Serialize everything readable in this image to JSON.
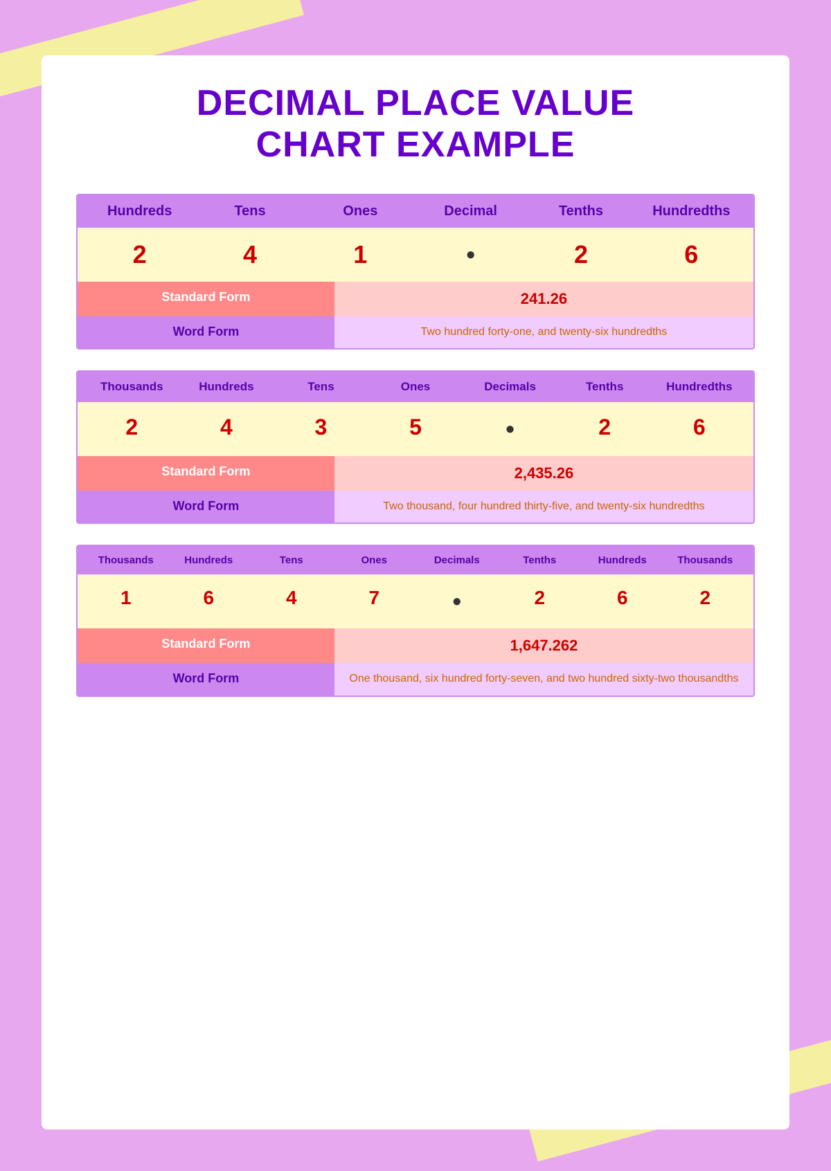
{
  "page": {
    "title_line1": "DECIMAL PLACE VALUE",
    "title_line2": "CHART EXAMPLE"
  },
  "charts": [
    {
      "id": "chart1",
      "cols": 6,
      "headers": [
        "Hundreds",
        "Tens",
        "Ones",
        "Decimal",
        "Tenths",
        "Hundredths"
      ],
      "digits": [
        "2",
        "4",
        "1",
        "•",
        "2",
        "6"
      ],
      "dot_index": 3,
      "standard_form_label": "Standard Form",
      "standard_form_value": "241.26",
      "word_form_label": "Word Form",
      "word_form_value": "Two hundred forty-one, and twenty-six hundredths"
    },
    {
      "id": "chart2",
      "cols": 7,
      "headers": [
        "Thousands",
        "Hundreds",
        "Tens",
        "Ones",
        "Decimals",
        "Tenths",
        "Hundredths"
      ],
      "digits": [
        "2",
        "4",
        "3",
        "5",
        "•",
        "2",
        "6"
      ],
      "dot_index": 4,
      "standard_form_label": "Standard Form",
      "standard_form_value": "2,435.26",
      "word_form_label": "Word Form",
      "word_form_value": "Two thousand, four hundred thirty-five, and twenty-six hundredths"
    },
    {
      "id": "chart3",
      "cols": 8,
      "headers": [
        "Thousands",
        "Hundreds",
        "Tens",
        "Ones",
        "Decimals",
        "Tenths",
        "Hundreds",
        "Thousands"
      ],
      "digits": [
        "1",
        "6",
        "4",
        "7",
        "•",
        "2",
        "6",
        "2"
      ],
      "dot_index": 4,
      "standard_form_label": "Standard Form",
      "standard_form_value": "1,647.262",
      "word_form_label": "Word Form",
      "word_form_value": "One thousand, six hundred forty-seven, and two hundred sixty-two thousandths"
    }
  ]
}
